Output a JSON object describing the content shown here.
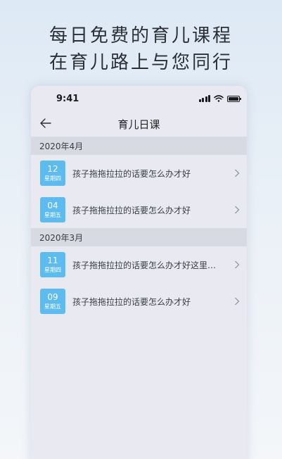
{
  "promo": {
    "line1": "每日免费的育儿课程",
    "line2": "在育儿路上与您同行"
  },
  "statusbar": {
    "time": "9:41"
  },
  "navbar": {
    "title": "育儿日课",
    "back_icon": "back-arrow-icon"
  },
  "sections": [
    {
      "header": "2020年4月",
      "items": [
        {
          "day": "12",
          "weekday": "星期四",
          "title": "孩子拖拖拉拉的话要怎么办才好"
        },
        {
          "day": "04",
          "weekday": "星期五",
          "title": "孩子拖拖拉拉的话要怎么办才好"
        }
      ]
    },
    {
      "header": "2020年3月",
      "items": [
        {
          "day": "11",
          "weekday": "星期四",
          "title": "孩子拖拖拉拉的话要怎么办才好这里给…"
        },
        {
          "day": "09",
          "weekday": "星期五",
          "title": "孩子拖拖拉拉的话要怎么办才好"
        }
      ]
    }
  ],
  "colors": {
    "badge": "#5dbcef",
    "section_bg": "#d8dae3",
    "screen_bg": "#e9eaf1"
  }
}
